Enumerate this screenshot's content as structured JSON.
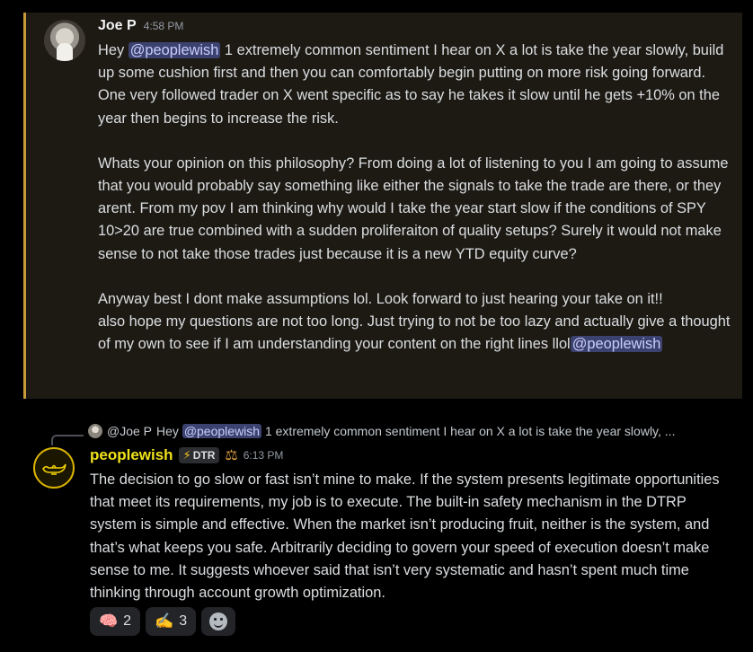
{
  "message1": {
    "username": "Joe P",
    "time": "4:58 PM",
    "p1": {
      "pre": "Hey ",
      "mention": "@peoplewish",
      "post": " 1 extremely common sentiment I hear on X a lot is take the year slowly, build up some cushion first and then you can comfortably begin putting on more risk going forward. One very followed trader on X went specific as to say he takes it slow until he gets +10% on the year  then begins to increase the risk."
    },
    "p2": "Whats your opinion on this philosophy? From doing a lot of listening to you I am going to assume that you would probably say something like either the signals to take the trade are there, or they arent.  From my pov I am thinking why would I take the year start slow if the conditions of SPY 10>20 are true combined with a sudden proliferaiton of quality setups? Surely it would not make sense to not take those trades just because it is a new YTD equity curve?",
    "p3": "Anyway best I dont make assumptions lol. Look forward to just hearing your take on it!!",
    "p4": {
      "pre": "also hope my questions are not too long. Just trying to not be too lazy and actually give a thought of my own to see if I am understanding your content on the right lines llol",
      "mention": "@peoplewish"
    }
  },
  "reply": {
    "ref_name": "@Joe P",
    "pre": "Hey ",
    "mention": "@peoplewish",
    "snippet": " 1 extremely common sentiment I hear on X a lot is take the year slowly, ..."
  },
  "message2": {
    "username": "peoplewish",
    "tag": "DTR",
    "time": "6:13 PM",
    "text": "The decision to go slow or fast isn’t mine to make. If the system presents legitimate opportunities that meet its requirements, my job is to execute. The built-in safety mechanism in the DTRP system is simple and effective. When the market isn’t producing fruit, neither is the system, and that’s what keeps you safe. Arbitrarily deciding to govern your speed of execution doesn’t make sense to me. It suggests whoever said that isn’t very systematic and hasn’t spent much time thinking through account growth optimization."
  },
  "reactions": [
    {
      "emoji": "🧠",
      "count": "2"
    },
    {
      "emoji": "✍️",
      "count": "3"
    }
  ],
  "colors": {
    "highlight_bg": "#1d1a14",
    "highlight_border": "#c99a3a",
    "mention_bg": "#3c4270",
    "username2": "#f0e21a"
  },
  "icons": [
    "lightning-icon",
    "scales-icon",
    "magic-lamp-icon",
    "add-reaction-icon"
  ]
}
